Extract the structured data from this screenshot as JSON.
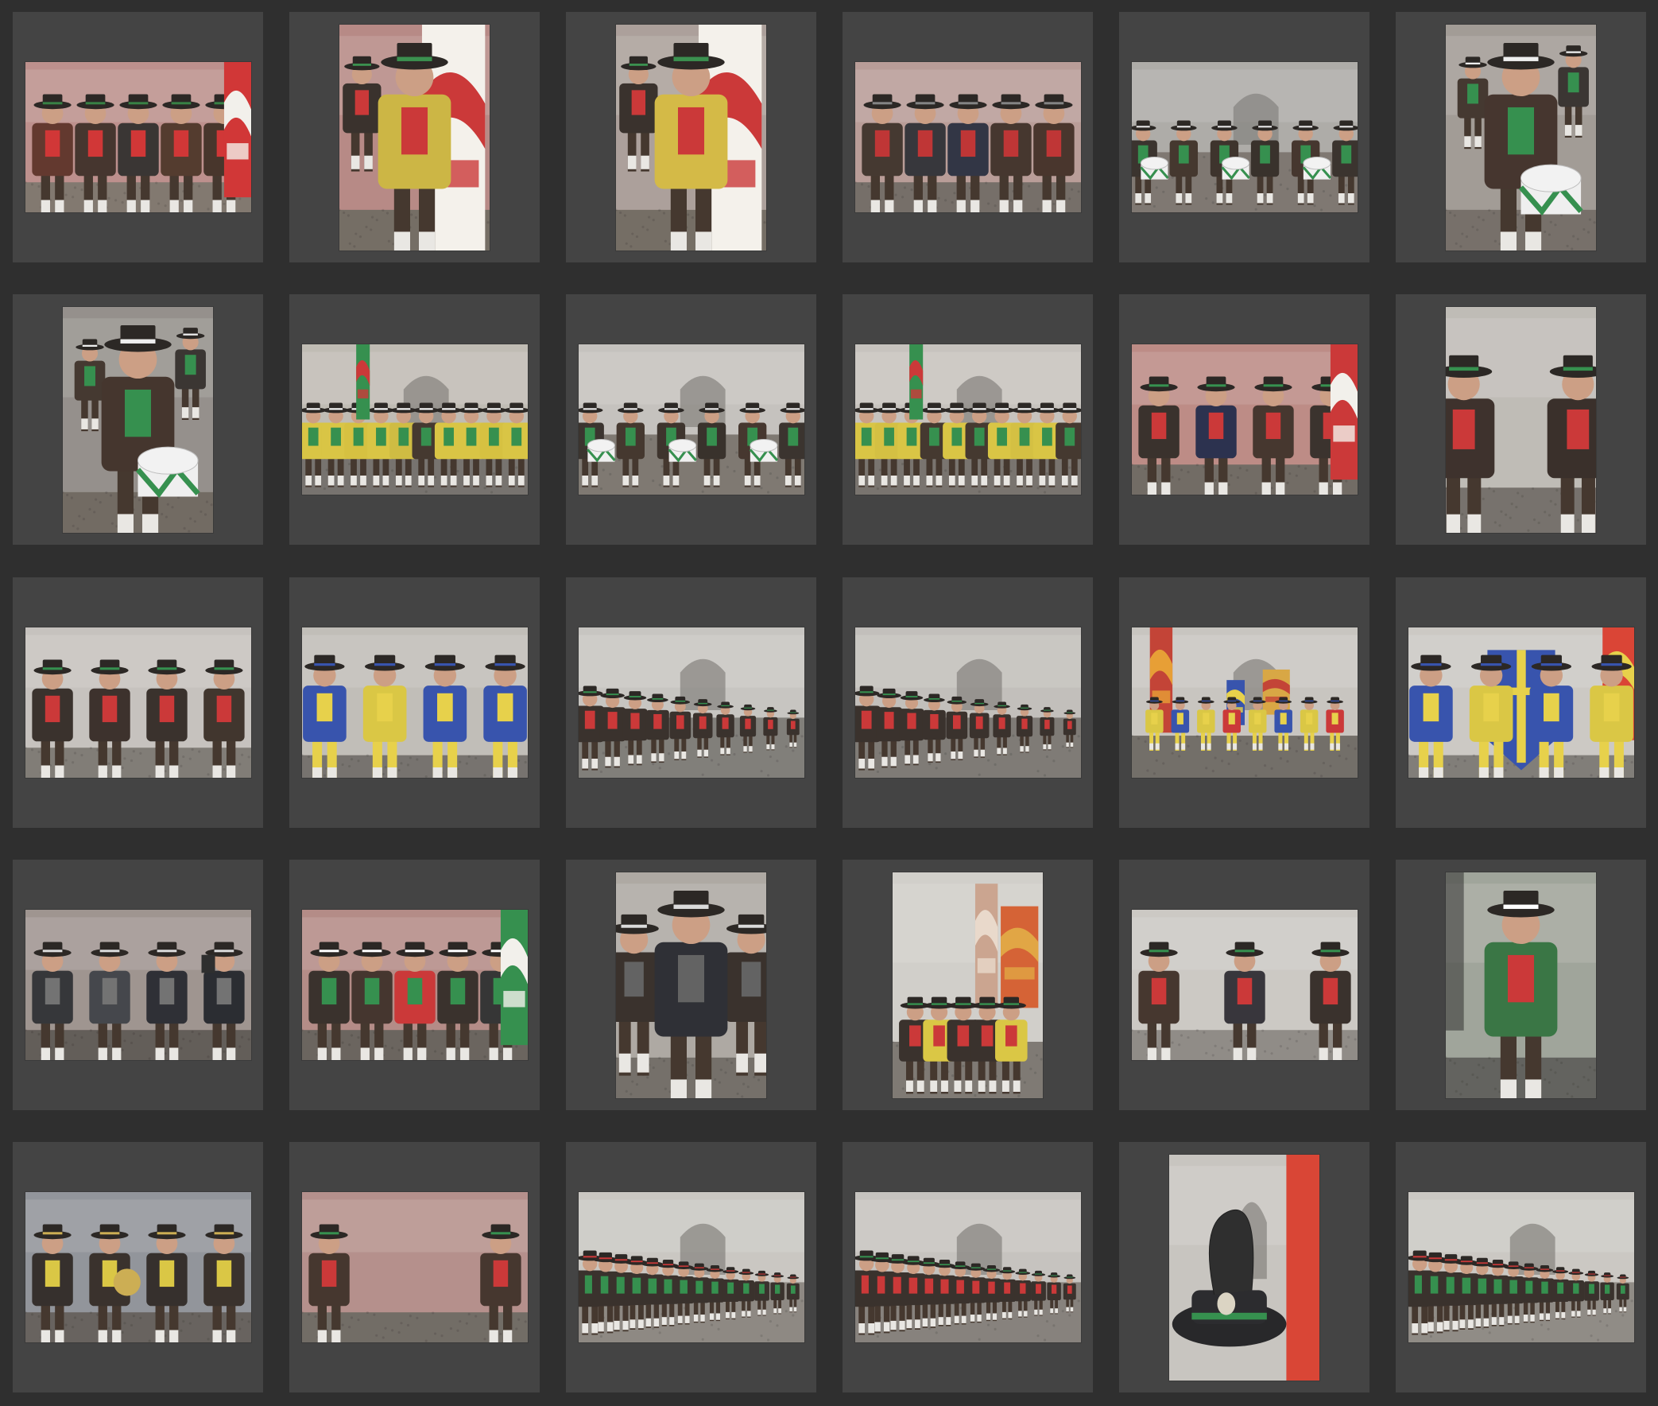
{
  "grid": {
    "columns": 6,
    "rows": 5,
    "thumbnails": [
      {
        "orientation": "landscape",
        "scene": "pink-wall",
        "bg": "#b98a86",
        "ground": "#7b7168",
        "figures": [
          "#5a2d22",
          "#3b2a22",
          "#2e2a28",
          "#4a3023",
          "#3d2a1f"
        ],
        "accents": [
          "#cf2b2b",
          "#2c7a3a",
          "#e8e2d6"
        ]
      },
      {
        "orientation": "portrait",
        "scene": "flag-man",
        "bg": "#b3837f",
        "ground": "#6d655c",
        "figures": [
          "#c9b23a",
          "#3b2a22"
        ],
        "accents": [
          "#c82d2d",
          "#2f8a45",
          "#eeeeee"
        ]
      },
      {
        "orientation": "portrait",
        "scene": "flag-man",
        "bg": "#a79b95",
        "ground": "#6d655c",
        "figures": [
          "#d2b63c",
          "#33281f"
        ],
        "accents": [
          "#c82d2d",
          "#2f8a45",
          "#eeeeee"
        ]
      },
      {
        "orientation": "landscape",
        "scene": "street-group",
        "bg": "#b59792",
        "ground": "#6e6760",
        "figures": [
          "#3a2d25",
          "#2b2b30",
          "#262a3a",
          "#3b2b22",
          "#3e2a20"
        ],
        "accents": [
          "#bb2a2a",
          "#7d7d7d",
          "#dddddd"
        ]
      },
      {
        "orientation": "landscape",
        "scene": "drummers",
        "bg": "#a9a7a3",
        "ground": "#77706a",
        "figures": [
          "#2f2822",
          "#3a2c22",
          "#322820",
          "#2d261f",
          "#3b2b22"
        ],
        "accents": [
          "#2a8a45",
          "#e9e9e9",
          "#c82d2d"
        ]
      },
      {
        "orientation": "portrait",
        "scene": "boy-drum",
        "bg": "#9d9690",
        "ground": "#6f6861",
        "figures": [
          "#3b2a22"
        ],
        "accents": [
          "#2a8a45",
          "#eeeeee",
          "#c82d2d"
        ]
      },
      {
        "orientation": "portrait",
        "scene": "boy-drum",
        "bg": "#8f8a85",
        "ground": "#6a625a",
        "figures": [
          "#3a2a21"
        ],
        "accents": [
          "#2a8a45",
          "#eeeeee",
          "#c82d2d"
        ]
      },
      {
        "orientation": "landscape",
        "scene": "yellow-line",
        "bg": "#bdb8b0",
        "ground": "#6f6b66",
        "figures": [
          "#d7c23a",
          "#d7c23a",
          "#d4be36",
          "#d7c23a",
          "#cdb838",
          "#3a2d24"
        ],
        "accents": [
          "#2a8a45",
          "#ffffff",
          "#b42a2a"
        ]
      },
      {
        "orientation": "landscape",
        "scene": "drummers",
        "bg": "#c2bfba",
        "ground": "#77716a",
        "figures": [
          "#2f2822",
          "#3a2c22",
          "#322820",
          "#2d261f",
          "#3b2b22"
        ],
        "accents": [
          "#2a8a45",
          "#eeeeee",
          "#c82d2d"
        ]
      },
      {
        "orientation": "landscape",
        "scene": "yellow-line",
        "bg": "#c4c0ba",
        "ground": "#716c66",
        "figures": [
          "#d7c23a",
          "#d2bd38",
          "#d7c23a",
          "#3a2d24",
          "#d7c23a",
          "#3a2d24"
        ],
        "accents": [
          "#2a8a45",
          "#ffffff",
          "#b42a2a"
        ]
      },
      {
        "orientation": "landscape",
        "scene": "officials",
        "bg": "#b9857f",
        "ground": "#6a635c",
        "figures": [
          "#2e2620",
          "#1f2644",
          "#3b2b22",
          "#2f2721"
        ],
        "accents": [
          "#c82d2d",
          "#2a8a45",
          "#e8c23a"
        ]
      },
      {
        "orientation": "portrait",
        "scene": "portrait-pair",
        "bg": "#bcb8b2",
        "ground": "#6f6a64",
        "figures": [
          "#322620",
          "#2e241e"
        ],
        "accents": [
          "#c82d2d",
          "#2a8a45",
          "#ffffff"
        ]
      },
      {
        "orientation": "landscape",
        "scene": "pair-wide",
        "bg": "#c3bfba",
        "ground": "#7a756f",
        "figures": [
          "#2e2620",
          "#312620",
          "#2e2620",
          "#362a21"
        ],
        "accents": [
          "#c82d2d",
          "#2a8a45",
          "#ffffff"
        ]
      },
      {
        "orientation": "landscape",
        "scene": "blue-yellow",
        "bg": "#bebab4",
        "ground": "#6f6b66",
        "figures": [
          "#2c4aa8",
          "#d8c43a",
          "#2c4aa8"
        ],
        "accents": [
          "#e6cf40",
          "#ffffff",
          "#c0392b"
        ]
      },
      {
        "orientation": "landscape",
        "scene": "line-up",
        "bg": "#c4c2be",
        "ground": "#7a7772",
        "figures": [
          "#2e2620",
          "#2e2620",
          "#2e2620",
          "#2e2620",
          "#2e2620",
          "#2e2620",
          "#2e2620"
        ],
        "accents": [
          "#c82d2d",
          "#2a8a45",
          "#ffffff"
        ]
      },
      {
        "orientation": "landscape",
        "scene": "line-up",
        "bg": "#bfbcb7",
        "ground": "#77736e",
        "figures": [
          "#2e2620",
          "#2e2620",
          "#2e2620",
          "#2e2620",
          "#2e2620",
          "#2e2620"
        ],
        "accents": [
          "#c82d2d",
          "#2a8a45",
          "#ffffff"
        ]
      },
      {
        "orientation": "landscape",
        "scene": "banners",
        "bg": "#c5c2bd",
        "ground": "#6b6660",
        "figures": [
          "#d8c43a",
          "#2c4aa8",
          "#d8c43a",
          "#c82d2d"
        ],
        "accents": [
          "#d6a23a",
          "#2c4aa8",
          "#c0392b"
        ]
      },
      {
        "orientation": "landscape",
        "scene": "blue-flag",
        "bg": "#c9c6c1",
        "ground": "#7a7671",
        "figures": [
          "#2c4aa8",
          "#d8c43a",
          "#2c4aa8",
          "#d8c43a"
        ],
        "accents": [
          "#2c4aa8",
          "#e6cf40",
          "#c0392b"
        ]
      },
      {
        "orientation": "landscape",
        "scene": "crowd-close",
        "bg": "#9a8f8a",
        "ground": "#5a544f",
        "figures": [
          "#2a2b2e",
          "#3a3c41",
          "#22242a",
          "#1e2026"
        ],
        "accents": [
          "#6b6b6b",
          "#d9d9d9",
          "#8a6b5a"
        ]
      },
      {
        "orientation": "landscape",
        "scene": "pink-wall",
        "bg": "#b08580",
        "ground": "#625c55",
        "figures": [
          "#2e2620",
          "#3a2a22",
          "#c82d2d",
          "#2e2620",
          "#2a2a2a"
        ],
        "accents": [
          "#2a8a45",
          "#ffffff",
          "#c82d2d"
        ]
      },
      {
        "orientation": "portrait",
        "scene": "man-coat",
        "bg": "#a9a49e",
        "ground": "#6d6861",
        "figures": [
          "#22242a",
          "#2e2620"
        ],
        "accents": [
          "#5a5a5a",
          "#d9d9d9",
          "#2a8a45"
        ]
      },
      {
        "orientation": "portrait",
        "scene": "standard",
        "bg": "#cfccc7",
        "ground": "#77726c",
        "figures": [
          "#2e2620",
          "#d8c43a",
          "#2e2620"
        ],
        "accents": [
          "#c8a08a",
          "#d35a2a",
          "#ffffff"
        ]
      },
      {
        "orientation": "landscape",
        "scene": "three-men",
        "bg": "#c9c6c1",
        "ground": "#8a8580",
        "figures": [
          "#3b2b22",
          "#2c2a30",
          "#2e2620"
        ],
        "accents": [
          "#c82d2d",
          "#2a8a45",
          "#ffffff"
        ]
      },
      {
        "orientation": "portrait",
        "scene": "green-jacket",
        "bg": "#9ba095",
        "ground": "#5a5a55",
        "figures": [
          "#2e6e3a"
        ],
        "accents": [
          "#c82d2d",
          "#ffffff",
          "#3a2a22"
        ]
      },
      {
        "orientation": "landscape",
        "scene": "band",
        "bg": "#8c8f95",
        "ground": "#5f5a55",
        "figures": [
          "#2a2420",
          "#2e2620",
          "#2a2420",
          "#2e2620"
        ],
        "accents": [
          "#d8c43a",
          "#c9a94a",
          "#c82d2d"
        ]
      },
      {
        "orientation": "landscape",
        "scene": "pair-close",
        "bg": "#b18a85",
        "ground": "#6a645d",
        "figures": [
          "#3b2b22",
          "#3b2b22"
        ],
        "accents": [
          "#c82d2d",
          "#2a8a45",
          "#ffffff"
        ]
      },
      {
        "orientation": "landscape",
        "scene": "long-line",
        "bg": "#c7c4bf",
        "ground": "#87827c",
        "figures": [
          "#2e2620",
          "#2e2620",
          "#2e2620",
          "#2e2620",
          "#2e2620",
          "#2e2620",
          "#2e2620",
          "#2e2620"
        ],
        "accents": [
          "#2a8a45",
          "#c82d2d",
          "#e0dcd6"
        ]
      },
      {
        "orientation": "landscape",
        "scene": "long-line",
        "bg": "#c3c0bb",
        "ground": "#807b75",
        "figures": [
          "#2e2620",
          "#2e2620",
          "#2e2620",
          "#2e2620",
          "#2e2620",
          "#2e2620",
          "#2e2620",
          "#2e2620"
        ],
        "accents": [
          "#c82d2d",
          "#2a8a45",
          "#e0dcd6"
        ]
      },
      {
        "orientation": "portrait",
        "scene": "hat-feather",
        "bg": "#c5c2bd",
        "ground": "#8a8680",
        "figures": [
          "#1f1f22"
        ],
        "accents": [
          "#d73b2a",
          "#2a8a45",
          "#d9d2c0"
        ]
      },
      {
        "orientation": "landscape",
        "scene": "long-line",
        "bg": "#c8c5c0",
        "ground": "#8a857f",
        "figures": [
          "#2e2620",
          "#2e2620",
          "#2e2620",
          "#2e2620",
          "#2e2620",
          "#2e2620",
          "#2e2620"
        ],
        "accents": [
          "#2a8a45",
          "#c82d2d",
          "#e0dcd6"
        ]
      }
    ]
  }
}
